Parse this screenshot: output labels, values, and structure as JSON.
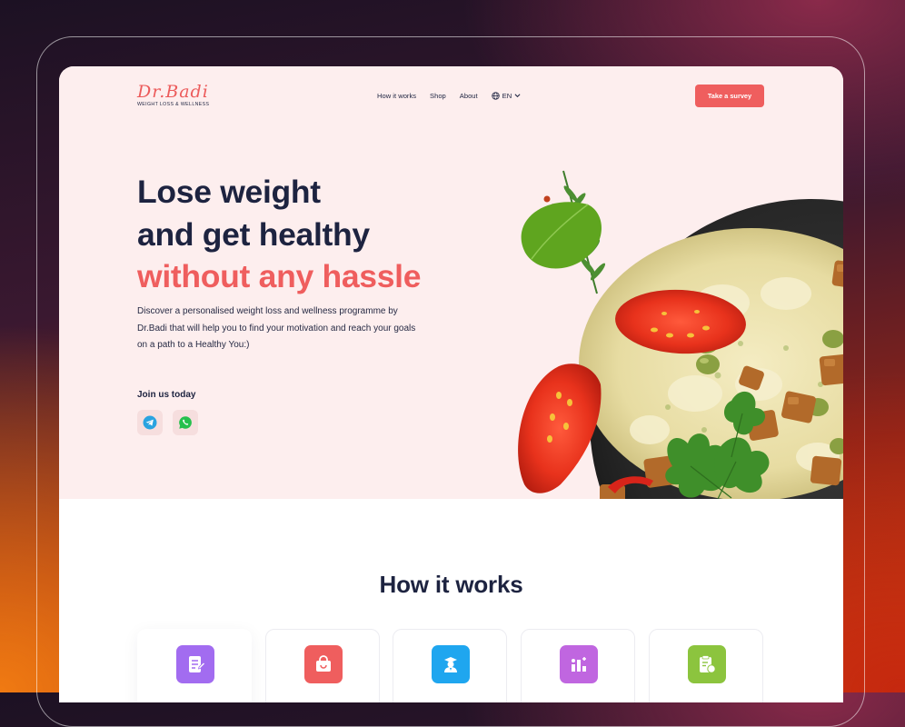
{
  "brand": {
    "name": "Dr.Badi",
    "tagline": "WEIGHT LOSS & WELLNESS",
    "accent": "#ef5e5e",
    "navy": "#1d2340"
  },
  "nav": {
    "items": [
      {
        "label": "How it works"
      },
      {
        "label": "Shop"
      },
      {
        "label": "About"
      }
    ],
    "language": {
      "value": "EN",
      "icon": "globe-icon"
    },
    "cta_label": "Take a survey"
  },
  "hero": {
    "headline_line1": "Lose weight",
    "headline_line2": "and get healthy",
    "headline_line3": "without any hassle",
    "description": "Discover a personalised weight loss and wellness programme by Dr.Badi that will help you to find your motivation and reach your goals on a path to a Healthy You:)",
    "join_label": "Join us today",
    "socials": [
      {
        "icon": "telegram-icon",
        "color": "#2aa3e0"
      },
      {
        "icon": "whatsapp-icon",
        "color": "#25c04d"
      }
    ]
  },
  "how_it_works": {
    "title": "How it works",
    "steps": [
      {
        "icon": "survey-icon",
        "color": "#a26cf0"
      },
      {
        "icon": "shopping-bag-icon",
        "color": "#ef5e5e"
      },
      {
        "icon": "doctor-icon",
        "color": "#1fa6ef"
      },
      {
        "icon": "progress-chart-icon",
        "color": "#c066e0"
      },
      {
        "icon": "nutrition-plan-icon",
        "color": "#8cc43e"
      }
    ]
  }
}
